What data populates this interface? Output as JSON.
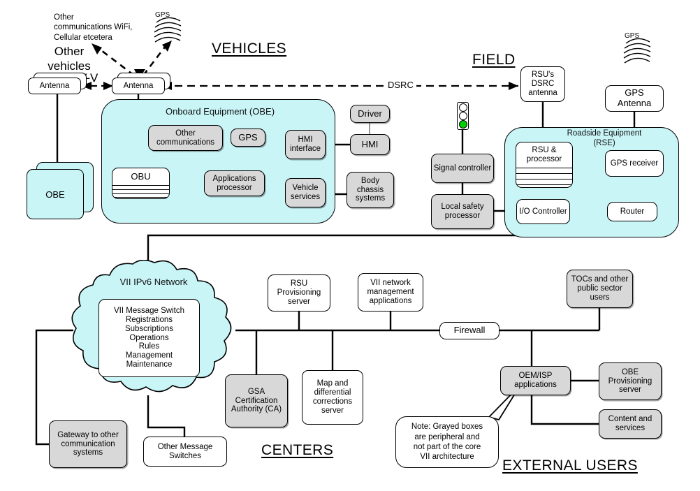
{
  "titles": {
    "vehicles": "VEHICLES",
    "field": "FIELD",
    "centers": "CENTERS",
    "external_users": "EXTERNAL USERS"
  },
  "annotations": {
    "other_comms": "Other\ncommunications WiFi,\nCellular etcetera",
    "other_vehicles": "Other\nvehicles",
    "vv": "V-V",
    "dsrc": "DSRC",
    "gps_symbol_left": "GPS",
    "gps_symbol_right": "GPS",
    "note": "Note: Grayed boxes\nare peripheral and\nnot part of the core\nVII architecture"
  },
  "zones": {
    "obe": {
      "label": "Onboard Equipment (OBE)"
    },
    "rse": {
      "label": "Roadside Equipment\n(RSE)"
    },
    "cloud": {
      "label": "VII IPv6 Network"
    }
  },
  "vehicles": {
    "other_antenna": "Antenna",
    "other_obe": "OBE",
    "antenna": "Antenna",
    "obu": "OBU",
    "other_communications": "Other\ncommunications",
    "gps": "GPS",
    "hmi_interface": "HMI\ninterface",
    "applications_processor": "Applications\nprocessor",
    "vehicle_services": "Vehicle\nservices",
    "driver": "Driver",
    "hmi": "HMI",
    "body_chassis": "Body\nchassis\nsystems"
  },
  "field": {
    "rsu_dsrc_antenna": "RSU's\nDSRC\nantenna",
    "gps_antenna": "GPS\nAntenna",
    "signal_controller": "Signal\ncontroller",
    "local_safety_processor": "Local\nsafety\nprocessor",
    "rsu_processor": "RSU &\nprocessor",
    "gps_receiver": "GPS\nreceiver",
    "io_controller": "I/O\nController",
    "router": "Router"
  },
  "centers": {
    "message_switch": "VII Message Switch\nRegistrations\nSubscriptions\nOperations\nRules\nManagement\nMaintenance",
    "rsu_provisioning_server": "RSU\nProvisioning\nserver",
    "vii_network_management": "VII network\nmanagement\napplications",
    "gsa_certification_authority": "GSA\nCertification\nAuthority\n(CA)",
    "map_corrections_server": "Map  and\ndifferential\ncorrections\nserver",
    "gateway_other_comm": "Gateway to\nother\ncommunication\nsystems",
    "other_message_switches": "Other Message\nSwitches"
  },
  "external": {
    "firewall": "Firewall",
    "tocs_public_sector": "TOCs and\nother public\nsector users",
    "oem_isp_applications": "OEM/ISP\napplications",
    "obe_provisioning_server": "OBE\nProvisioning\nserver",
    "content_and_services": "Content and\nservices"
  },
  "colors": {
    "cyan_zone": "#c9f5f7",
    "gray_box": "#d8d8d8",
    "white_box": "#ffffff",
    "signal_green": "#00d000",
    "line": "#000000"
  }
}
